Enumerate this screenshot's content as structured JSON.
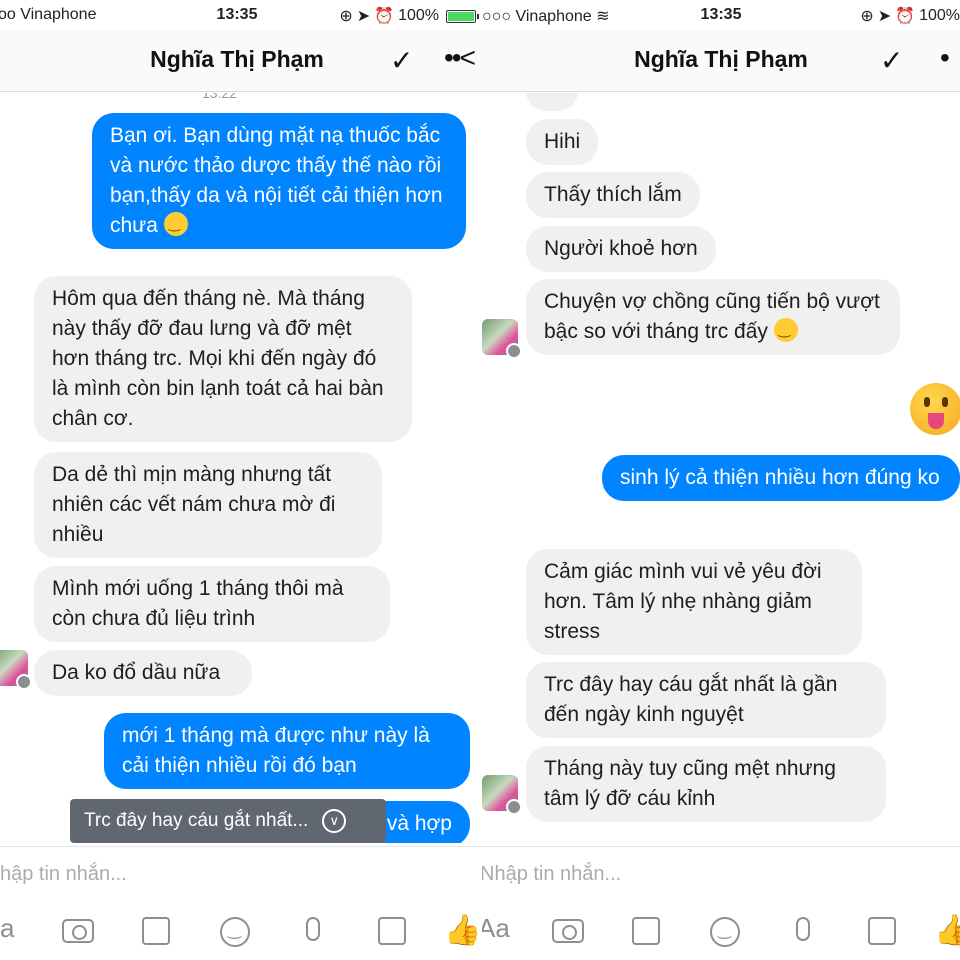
{
  "status": {
    "carrier": "Vinaphone",
    "time": "13:35",
    "battery": "100%"
  },
  "left": {
    "status_carrier_fragment": "oo Vinaphone",
    "header_title": "Nghĩa Thị Phạm",
    "header_check": "✓",
    "header_more": "••<",
    "timestamp_fragment": "13:22",
    "messages": [
      {
        "dir": "out",
        "text": "Bạn ơi. Bạn dùng mặt nạ thuốc bắc và nước thảo dược thấy thế nào rồi bạn,thấy da và nội tiết cải thiện hơn chưa"
      },
      {
        "dir": "in",
        "text": "Hôm qua đến tháng nè. Mà tháng này thấy đỡ đau lưng và đỡ mệt hơn tháng trc. Mọi khi đến ngày đó là mình còn bin lạnh toát cả hai bàn chân cơ."
      },
      {
        "dir": "in",
        "text": "Da dẻ thì mịn màng nhưng tất nhiên các vết nám chưa mờ đi nhiều"
      },
      {
        "dir": "in",
        "text": "Mình mới uống 1 tháng thôi mà còn chưa đủ liệu trình"
      },
      {
        "dir": "in",
        "text": "Da ko đổ dầu nữa"
      },
      {
        "dir": "out",
        "text": "mới 1 tháng mà được như này là cải thiện nhiều rồi đó bạn"
      },
      {
        "dir": "out",
        "text": "và hợp"
      }
    ],
    "toast": "Trc đây hay cáu gắt nhất...",
    "composer_placeholder": "hập tin nhắn...",
    "composer_aa": "a"
  },
  "right": {
    "header_title": "Nghĩa Thị Phạm",
    "header_check": "✓",
    "header_more": "•",
    "messages": [
      {
        "dir": "in",
        "text": "Hihi"
      },
      {
        "dir": "in",
        "text": "Thấy thích lắm"
      },
      {
        "dir": "in",
        "text": "Người khoẻ hơn"
      },
      {
        "dir": "in",
        "text": "Chuyện vợ chồng cũng tiến bộ vượt bậc so với tháng trc đấy"
      },
      {
        "dir": "out",
        "text": "sinh lý cả thiện nhiều hơn đúng ko"
      },
      {
        "dir": "in",
        "text": "Cảm giác mình vui vẻ yêu đời hơn. Tâm lý nhẹ nhàng giảm stress"
      },
      {
        "dir": "in",
        "text": "Trc đây hay cáu gắt nhất là gần đến ngày kinh nguyệt"
      },
      {
        "dir": "in",
        "text": "Tháng này tuy cũng mệt nhưng tâm lý đỡ cáu kỉnh"
      }
    ],
    "composer_placeholder": "Nhập tin nhắn...",
    "composer_aa": "Aa"
  },
  "icons": {
    "wifi": "wifi-icon",
    "lock_rotation": "rotation-lock-icon",
    "location": "location-arrow-icon",
    "alarm": "alarm-icon",
    "camera": "camera-icon",
    "gallery": "gallery-icon",
    "emoji": "emoji-icon",
    "mic": "microphone-icon",
    "sticker": "sticker-icon",
    "like": "thumbs-up-icon"
  },
  "colors": {
    "outgoing_bubble": "#0084ff",
    "incoming_bubble": "#f1f0f0",
    "battery": "#4cd964"
  }
}
